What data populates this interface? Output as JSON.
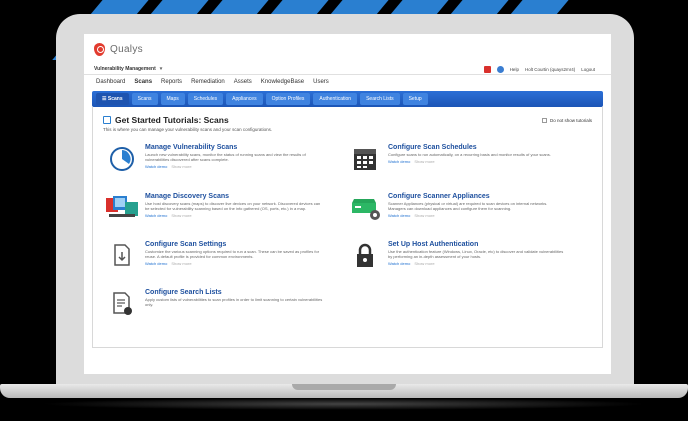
{
  "brand": {
    "logo_text": "Qualys",
    "accent": "#e23b2e"
  },
  "module_bar": {
    "module": "Vulnerability Management",
    "links": [
      "Help",
      "Holt Courtin (quays2mr4)",
      "Logout"
    ]
  },
  "nav": {
    "items": [
      "Dashboard",
      "Scans",
      "Reports",
      "Remediation",
      "Assets",
      "KnowledgeBase",
      "Users"
    ],
    "active": "Scans"
  },
  "tabs": {
    "home_label": "Scans",
    "items": [
      "Scans",
      "Maps",
      "Schedules",
      "Appliances",
      "Option Profiles",
      "Authentication",
      "Search Lists",
      "Setup"
    ]
  },
  "panel": {
    "title": "Get Started Tutorials: Scans",
    "subtitle": "This is where you can manage your vulnerability scans and your scan configurations.",
    "checkbox_label": "Do not show tutorials"
  },
  "cards": [
    {
      "title": "Manage Vulnerability Scans",
      "desc": "Launch new vulnerability scans, monitor the status of running scans and view the results of vulnerabilities discovered after scans complete.",
      "watch": "Watch demo",
      "more": "Show more"
    },
    {
      "title": "Configure Scan Schedules",
      "desc": "Configure scans to run automatically, on a recurring basis and monitor results of your scans.",
      "watch": "Watch demo",
      "more": "Show more"
    },
    {
      "title": "Manage Discovery Scans",
      "desc": "Use host discovery scans (maps) to discover live devices on your network. Discovered devices can be selected for vulnerability scanning based on the info gathered (OS, ports, etc.) in a map.",
      "watch": "Watch demo",
      "more": "Show more"
    },
    {
      "title": "Configure Scanner Appliances",
      "desc": "Scanner Appliances (physical or virtual) are required to scan devices on internal networks. Managers can download appliances and configure them for scanning.",
      "watch": "Watch demo",
      "more": "Show more"
    },
    {
      "title": "Configure Scan Settings",
      "desc": "Customize the various scanning options required to run a scan. These can be saved as profiles for reuse. A default profile is provided for common environments.",
      "watch": "Watch demo",
      "more": "Show more"
    },
    {
      "title": "Set Up Host Authentication",
      "desc": "Use the authentication feature (Windows, Linux, Oracle, etc) to discover and validate vulnerabilities by performing an in-depth assessment of your hosts.",
      "watch": "Watch demo",
      "more": "Show more"
    },
    {
      "title": "Configure Search Lists",
      "desc": "Apply custom lists of vulnerabilities to scan profiles in order to limit scanning to certain vulnerabilities only.",
      "watch": "",
      "more": ""
    }
  ],
  "colors": {
    "tab_blue": "#1c55b6",
    "link_blue": "#1d4f9e",
    "stripe": "#2a7fd0"
  }
}
